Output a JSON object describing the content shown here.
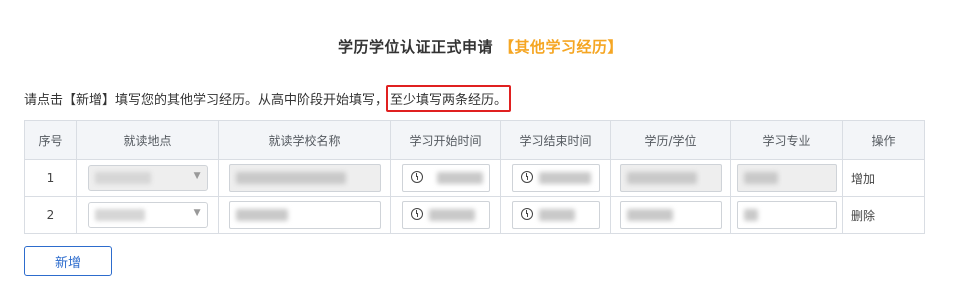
{
  "page": {
    "title": "学历学位认证正式申请",
    "title_suffix": "【其他学习经历】",
    "notice_prefix": "请点击【新增】填写您的其他学习经历。从高中阶段开始填写，",
    "notice_highlight": "至少填写两条经历。"
  },
  "colors": {
    "accent": "#f5a623",
    "primary": "#2d6ccd",
    "highlight_border": "#e02020"
  },
  "table": {
    "headers": [
      "序号",
      "就读地点",
      "就读学校名称",
      "学习开始时间",
      "学习结束时间",
      "学历/学位",
      "学习专业",
      "操作"
    ],
    "rows": [
      {
        "index": "1",
        "location": "",
        "school": "",
        "start": "",
        "end": "",
        "degree": "",
        "major": "",
        "action": "增加"
      },
      {
        "index": "2",
        "location": "",
        "school": "",
        "start": "",
        "end": "",
        "degree": "",
        "major": "",
        "action": "删除"
      }
    ]
  },
  "buttons": {
    "add_label": "新增"
  }
}
